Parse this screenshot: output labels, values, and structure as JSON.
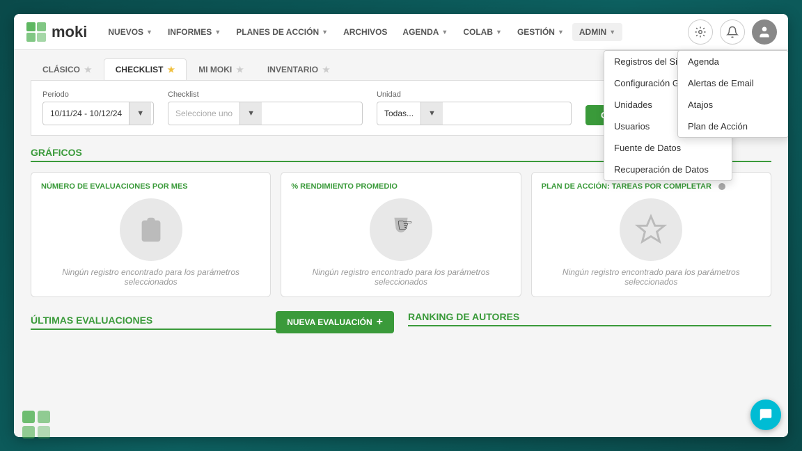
{
  "app": {
    "name": "moki"
  },
  "navbar": {
    "items": [
      {
        "id": "nuevos",
        "label": "NUEVOS",
        "has_dropdown": true
      },
      {
        "id": "informes",
        "label": "INFORMES",
        "has_dropdown": true
      },
      {
        "id": "planes",
        "label": "PLANES DE ACCIÓN",
        "has_dropdown": true
      },
      {
        "id": "archivos",
        "label": "ARCHIVOS",
        "has_dropdown": false
      },
      {
        "id": "agenda",
        "label": "AGENDA",
        "has_dropdown": true
      },
      {
        "id": "colab",
        "label": "COLAB",
        "has_dropdown": true
      },
      {
        "id": "gestion",
        "label": "GESTIÓN",
        "has_dropdown": true
      },
      {
        "id": "admin",
        "label": "ADMIN",
        "has_dropdown": true,
        "active": true
      }
    ]
  },
  "tabs": [
    {
      "id": "clasico",
      "label": "CLÁSICO",
      "active": false
    },
    {
      "id": "checklist",
      "label": "CHECKLIST",
      "active": true
    },
    {
      "id": "mi-moki",
      "label": "MI MOKI",
      "active": false
    },
    {
      "id": "inventario",
      "label": "INVENTARIO",
      "active": false
    }
  ],
  "filters": {
    "periodo_label": "Periodo",
    "periodo_value": "10/11/24 - 10/12/24",
    "checklist_label": "Checklist",
    "checklist_placeholder": "Seleccione uno",
    "unidad_label": "Unidad",
    "unidad_value": "Todas...",
    "ok_button": "OK"
  },
  "graficos": {
    "section_title": "GRÁFICOS",
    "cards": [
      {
        "id": "evaluaciones",
        "title": "NÚMERO DE EVALUACIONES POR MES",
        "empty_text": "Ningún registro encontrado para los parámetros seleccionados",
        "icon": "list"
      },
      {
        "id": "rendimiento",
        "title": "% RENDIMIENTO PROMEDIO",
        "empty_text": "Ningún registro encontrado para los parámetros seleccionados",
        "icon": "trophy"
      },
      {
        "id": "plan-accion",
        "title": "PLAN DE ACCIÓN: TAREAS POR COMPLETAR",
        "empty_text": "Ningún registro encontrado para los parámetros seleccionados",
        "icon": "target"
      }
    ]
  },
  "bottom": {
    "ultimas_title": "ÚLTIMAS EVALUACIONES",
    "nueva_button": "NUEVA EVALUACIÓN",
    "ranking_title": "RANKING DE AUTORES"
  },
  "admin_menu": {
    "items": [
      {
        "id": "registros",
        "label": "Registros del Sistema",
        "has_sub": true
      },
      {
        "id": "config",
        "label": "Configuración General",
        "has_sub": true
      },
      {
        "id": "unidades",
        "label": "Unidades",
        "has_sub": false
      },
      {
        "id": "usuarios",
        "label": "Usuarios",
        "has_sub": false
      },
      {
        "id": "fuente",
        "label": "Fuente de Datos",
        "has_sub": false
      },
      {
        "id": "recuperacion",
        "label": "Recuperación de Datos",
        "has_sub": false
      }
    ]
  },
  "registros_submenu": {
    "items": [
      {
        "id": "agenda",
        "label": "Agenda"
      },
      {
        "id": "alertas",
        "label": "Alertas de Email"
      },
      {
        "id": "atajos",
        "label": "Atajos"
      },
      {
        "id": "plan-accion",
        "label": "Plan de Acción"
      }
    ]
  }
}
